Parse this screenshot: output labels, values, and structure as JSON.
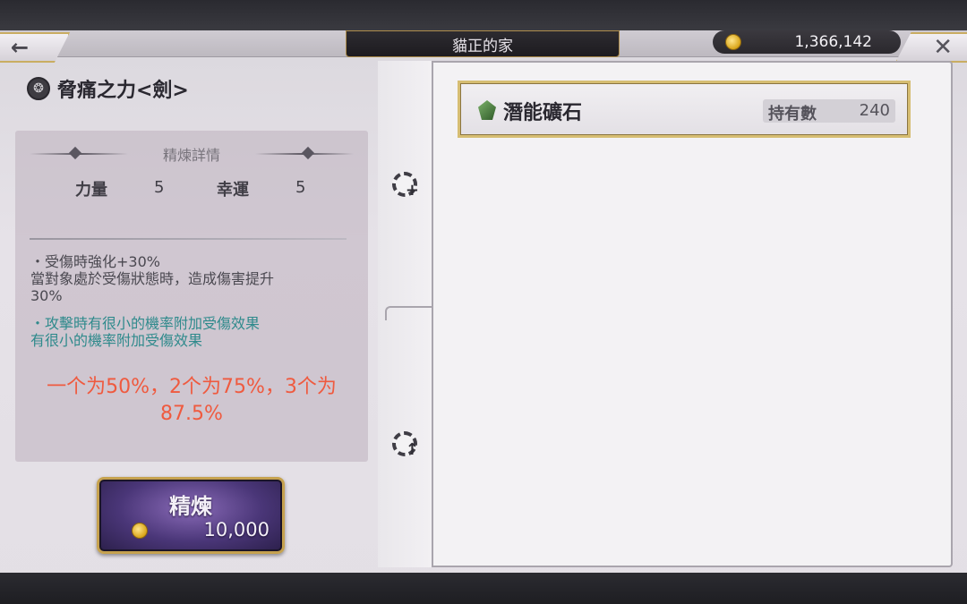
{
  "header": {
    "title": "貓正的家",
    "currency_amount": "1,366,142",
    "back_icon": "back-arrow-icon",
    "close_icon": "close-icon"
  },
  "item": {
    "name": "脅痛之力<劍>"
  },
  "details": {
    "heading": "精煉詳情",
    "stats": [
      {
        "label": "力量",
        "value": "5"
      },
      {
        "label": "幸運",
        "value": "5"
      }
    ],
    "effect1_line1": "・受傷時強化+30%",
    "effect1_line2": "當對象處於受傷狀態時，造成傷害提升",
    "effect1_line3": "30%",
    "effect2_line1": "・攻擊時有很小的機率附加受傷效果",
    "effect2_line2": "有很小的機率附加受傷效果",
    "note_line1": "一个为50%，2个为75%，3个为",
    "note_line2": "87.5%"
  },
  "refine": {
    "label": "精煉",
    "cost": "10,000"
  },
  "material": {
    "name": "潛能礦石",
    "owned_label": "持有數",
    "owned_value": "240"
  },
  "colors": {
    "accent_gold": "#c9ad62",
    "note_red": "#ef5a3f",
    "effect_teal": "#2f8a8c",
    "button_purple": "#4a3678"
  }
}
